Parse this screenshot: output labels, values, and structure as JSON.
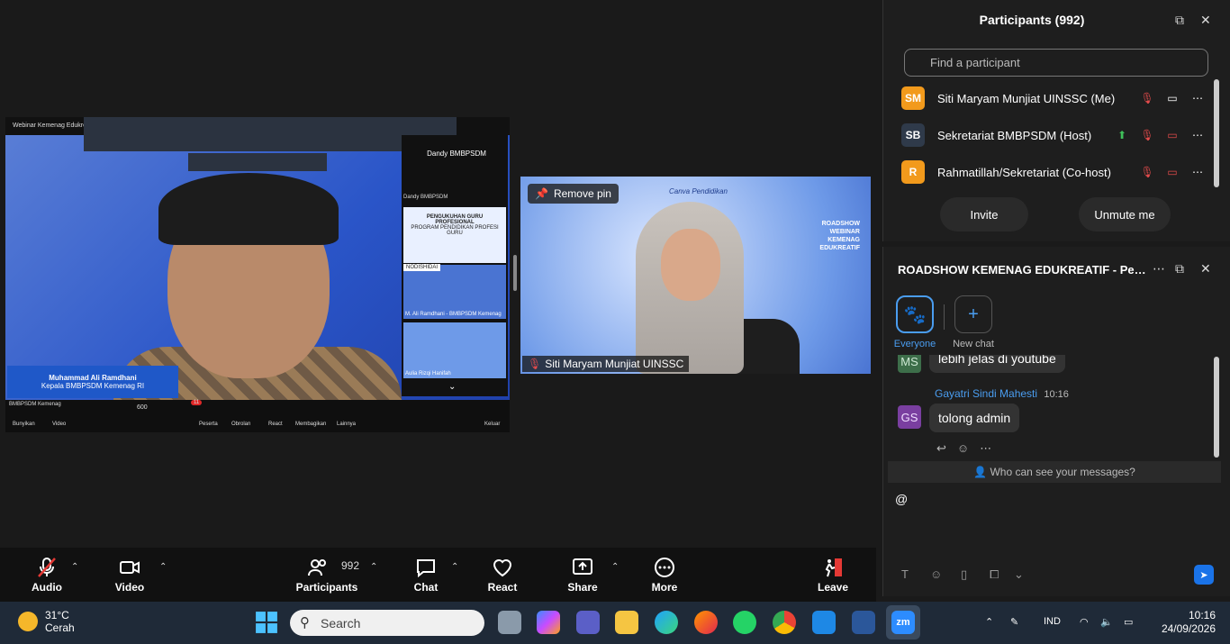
{
  "video": {
    "main_tile": {
      "top_label": "Webinar Kemenag Edukreatif",
      "gallery_host": "Dandy BMBPSDM",
      "gallery_sub": "Dandy BMBPSDM",
      "slide_title": "PENGUKUHAN GURU PROFESIONAL",
      "slide_sub": "PROGRAM PENDIDIKAN PROFESI GURU",
      "tag1": "NODISHIDAI",
      "gallery_name2": "M. Ali Ramdhani - BMBPSDM Kemenag",
      "gallery_name3": "Aulia Rizqi Hanifah",
      "speaker_name": "Muhammad Ali Ramdhani",
      "speaker_title": "Kepala BMBPSDM Kemenag RI",
      "mini_name": "BMBPSDM Kemenag",
      "mini_count": "600",
      "mini_badge": "11",
      "mini_labels": {
        "audio": "Bunyikan",
        "video": "Video",
        "participants": "Peserta",
        "chat": "Obrolan",
        "react": "React",
        "share": "Membagikan",
        "more": "Lainnya",
        "leave": "Keluar"
      }
    },
    "pinned_tile": {
      "remove_pin": "Remove pin",
      "name": "Siti Maryam Munjiat UINSSC",
      "canva": "Canva Pendidikan",
      "webinar_lines": [
        "ROADSHOW",
        "WEBINAR",
        "KEMENAG",
        "EDUKREATIF"
      ]
    }
  },
  "toolbar": {
    "audio": "Audio",
    "video": "Video",
    "participants": "Participants",
    "participants_count": "992",
    "chat": "Chat",
    "react": "React",
    "share": "Share",
    "more": "More",
    "leave": "Leave"
  },
  "participants_panel": {
    "title": "Participants (992)",
    "search_placeholder": "Find a participant",
    "rows": [
      {
        "initials": "SM",
        "color": "#f29a1c",
        "name": "Siti Maryam Munjiat UINSSC (Me)"
      },
      {
        "initials": "SB",
        "color": "#2f3a4a",
        "name": "Sekretariat BMBPSDM (Host)"
      },
      {
        "initials": "R",
        "color": "#f29a1c",
        "name": "Rahmatillah/Sekretariat (Co-host)"
      }
    ],
    "invite": "Invite",
    "unmute": "Unmute me"
  },
  "chat_panel": {
    "title": "ROADSHOW KEMENAG EDUKREATIF - Pen...",
    "tabs": {
      "everyone": "Everyone",
      "new_chat": "New chat"
    },
    "messages": [
      {
        "avatar": "MS",
        "text": "lebih jelas di youtube"
      },
      {
        "avatar": "GS",
        "sender": "Gayatri Sindi Mahesti",
        "time": "10:16",
        "text": "tolong admin"
      }
    ],
    "who_can_see": "Who can see your messages?",
    "compose_text": "@"
  },
  "taskbar": {
    "weather_temp": "31°C",
    "weather_desc": "Cerah",
    "search_placeholder": "Search",
    "lang": "IND",
    "time": "10:16",
    "date": "24/09/2026"
  }
}
